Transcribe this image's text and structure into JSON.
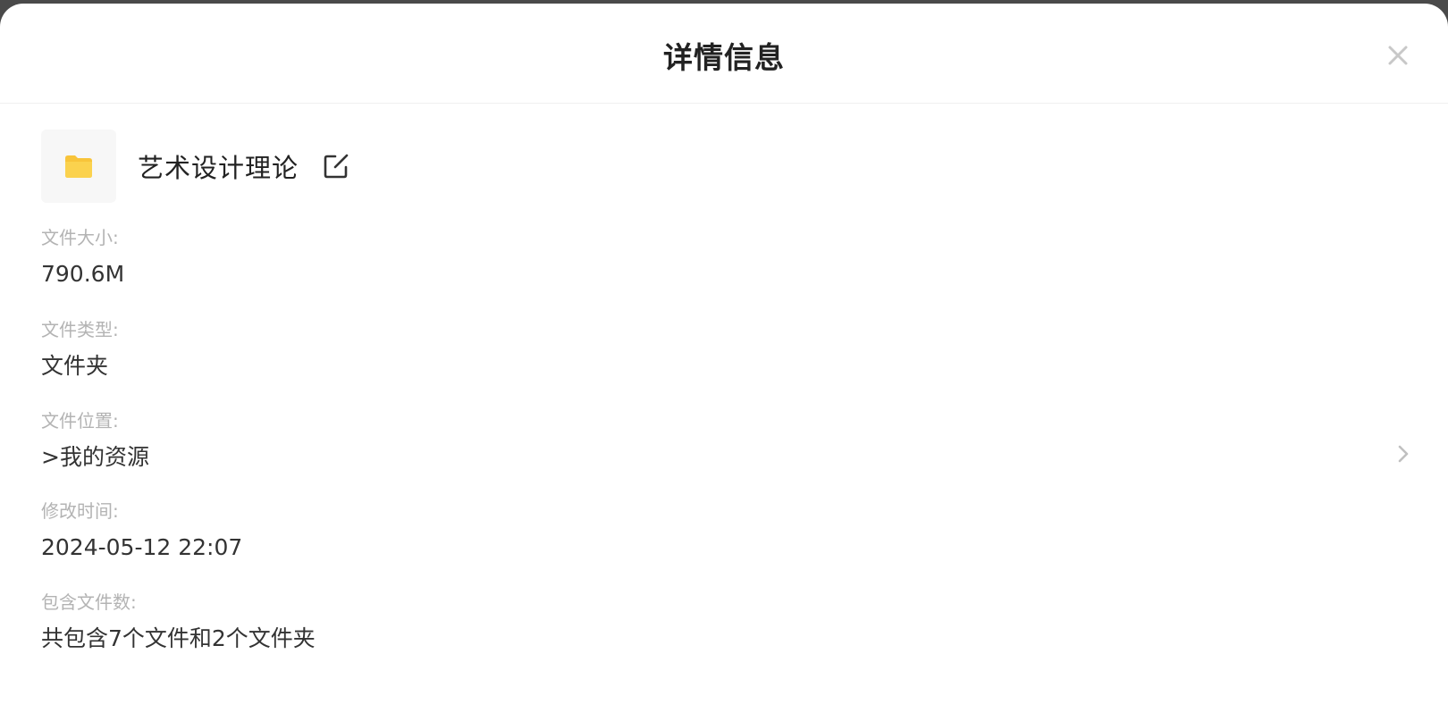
{
  "dialog": {
    "title": "详情信息"
  },
  "file": {
    "name": "艺术设计理论",
    "icon": "folder-icon",
    "folder_color": "#F8C43A"
  },
  "fields": {
    "size": {
      "label": "文件大小:",
      "value": "790.6M"
    },
    "type": {
      "label": "文件类型:",
      "value": "文件夹"
    },
    "location": {
      "label": "文件位置:",
      "value": ">我的资源"
    },
    "modified": {
      "label": "修改时间:",
      "value": "2024-05-12 22:07"
    },
    "contents": {
      "label": "包含文件数:",
      "value": "共包含7个文件和2个文件夹"
    }
  }
}
